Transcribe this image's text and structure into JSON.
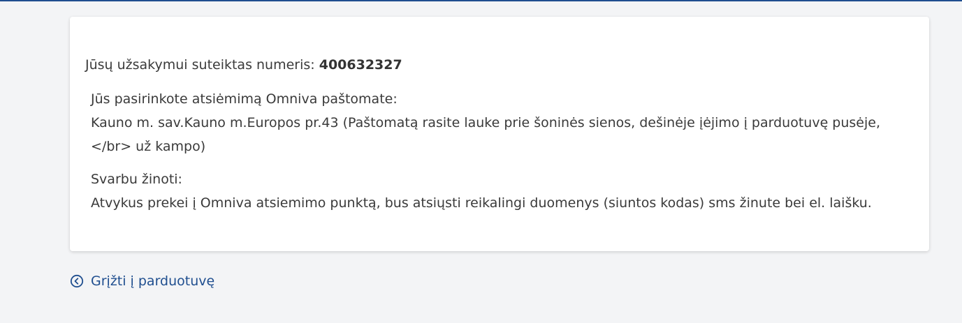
{
  "order": {
    "label": "Jūsų užsakymui suteiktas numeris: ",
    "number": "400632327"
  },
  "pickup": {
    "heading": "Jūs pasirinkote atsiėmimą Omniva paštomate:",
    "address_line1": "Kauno m. sav.Kauno m.Europos pr.43 (Paštomatą rasite lauke prie šoninės sienos, dešinėje įėjimo į parduotuvę pusėje,",
    "address_line2": "</br> už kampo)"
  },
  "important": {
    "heading": "Svarbu žinoti:",
    "text": "Atvykus prekei į Omniva atsiemimo punktą, bus atsiųsti reikalingi duomenys (siuntos kodas) sms žinute bei el. laišku."
  },
  "back_link": {
    "label": "Grįžti į parduotuvę",
    "icon": "chevron-left-circle-icon"
  },
  "colors": {
    "link": "#1f4e8f",
    "background": "#f3f4f6",
    "card": "#ffffff",
    "top_border": "#1f4e8f"
  }
}
